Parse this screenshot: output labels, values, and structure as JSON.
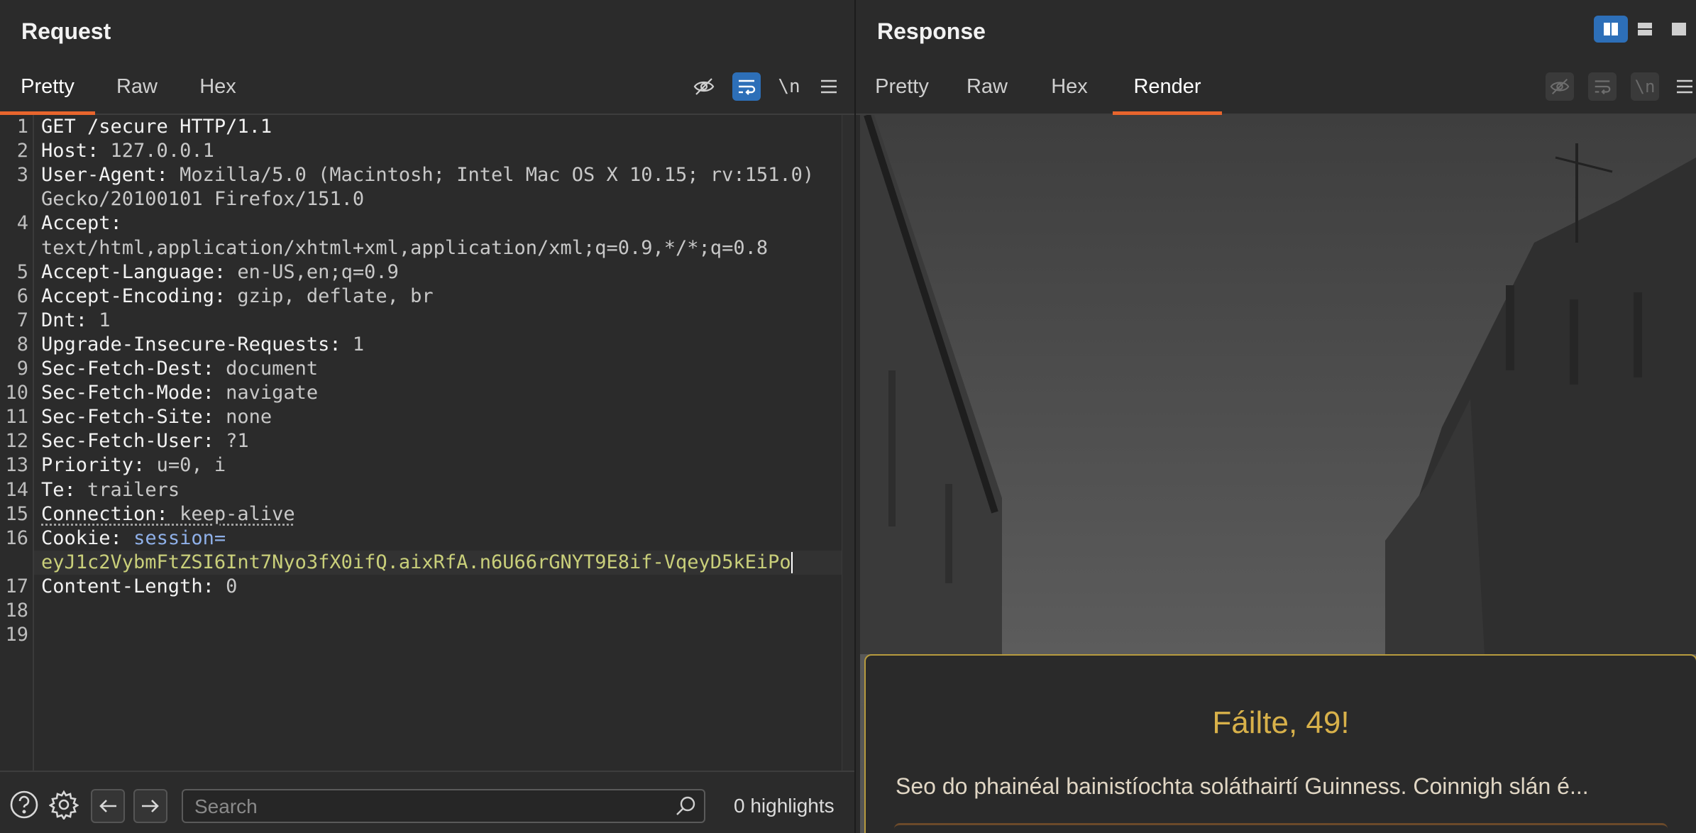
{
  "request": {
    "title": "Request",
    "tabs": [
      {
        "label": "Pretty",
        "active": true
      },
      {
        "label": "Raw",
        "active": false
      },
      {
        "label": "Hex",
        "active": false
      }
    ],
    "toolbar": {
      "newline_label": "\\n"
    },
    "lines": [
      {
        "n": "1",
        "key": "GET /secure HTTP/1.1",
        "val": ""
      },
      {
        "n": "2",
        "key": "Host:",
        "val": " 127.0.0.1"
      },
      {
        "n": "3",
        "key": "User-Agent:",
        "val": " Mozilla/5.0 (Macintosh; Intel Mac OS X 10.15; rv:151.0)"
      },
      {
        "n": "",
        "key": "",
        "val": "Gecko/20100101 Firefox/151.0"
      },
      {
        "n": "4",
        "key": "Accept:",
        "val": ""
      },
      {
        "n": "",
        "key": "",
        "val": "text/html,application/xhtml+xml,application/xml;q=0.9,*/*;q=0.8"
      },
      {
        "n": "5",
        "key": "Accept-Language:",
        "val": " en-US,en;q=0.9"
      },
      {
        "n": "6",
        "key": "Accept-Encoding:",
        "val": " gzip, deflate, br"
      },
      {
        "n": "7",
        "key": "Dnt:",
        "val": " 1"
      },
      {
        "n": "8",
        "key": "Upgrade-Insecure-Requests:",
        "val": " 1"
      },
      {
        "n": "9",
        "key": "Sec-Fetch-Dest:",
        "val": " document"
      },
      {
        "n": "10",
        "key": "Sec-Fetch-Mode:",
        "val": " navigate"
      },
      {
        "n": "11",
        "key": "Sec-Fetch-Site:",
        "val": " none"
      },
      {
        "n": "12",
        "key": "Sec-Fetch-User:",
        "val": " ?1"
      },
      {
        "n": "13",
        "key": "Priority:",
        "val": " u=0, i"
      },
      {
        "n": "14",
        "key": "Te:",
        "val": " trailers"
      },
      {
        "n": "15",
        "key": "Connection:",
        "val": " keep-alive"
      },
      {
        "n": "16",
        "key": "Cookie:",
        "val": " ",
        "cookie_name": "session=",
        "cookie": true
      },
      {
        "n": "",
        "key": "",
        "val": "eyJ1c2VybmFtZSI6Int7Nyo3fX0ifQ.aixRfA.n6U66rGNYT9E8if-VqeyD5kEiPo",
        "cookie_value": true
      },
      {
        "n": "17",
        "key": "Content-Length:",
        "val": " 0"
      },
      {
        "n": "18",
        "key": "",
        "val": ""
      },
      {
        "n": "19",
        "key": "",
        "val": ""
      }
    ],
    "search": {
      "placeholder": "Search",
      "value": ""
    },
    "highlights": "0 highlights"
  },
  "response": {
    "title": "Response",
    "tabs": [
      {
        "label": "Pretty",
        "active": false
      },
      {
        "label": "Raw",
        "active": false
      },
      {
        "label": "Hex",
        "active": false
      },
      {
        "label": "Render",
        "active": true
      }
    ],
    "toolbar": {
      "newline_label": "\\n"
    },
    "render": {
      "heading": "Fáilte, 49!",
      "text": "Seo do phainéal bainistíochta soláthairtí Guinness. Coinnigh slán é..."
    }
  },
  "colors": {
    "accent": "#e8652d",
    "toggle_on": "#2d6fb8",
    "card_border": "#b79b3e",
    "card_heading": "#d8b14a"
  }
}
